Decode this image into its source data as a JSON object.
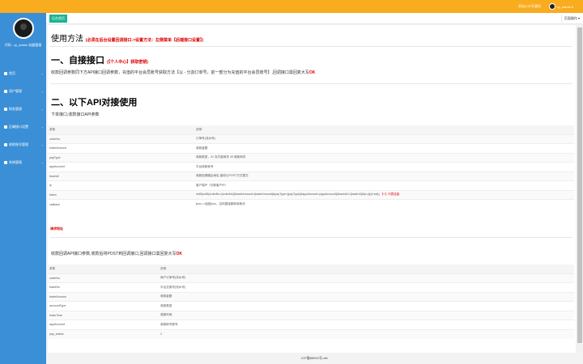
{
  "topbar": {
    "tip": "添加公众号通知",
    "username": "xy_admin"
  },
  "sidebar": {
    "user": "代码 : xy_admin  机器管理",
    "items": [
      {
        "label": "首页"
      },
      {
        "label": "用户管理"
      },
      {
        "label": "财务管理"
      },
      {
        "label": "后端接口设置"
      },
      {
        "label": "收款账号管理"
      },
      {
        "label": "系统管理"
      }
    ]
  },
  "tabs": {
    "active": "后台首页",
    "right": "页面操作"
  },
  "main": {
    "title": "使用方法",
    "title_note": "(必须在后台设置回调接口->设置方法：左侧菜单【后端接口设置】)",
    "section1": {
      "heading": "一、自接接口",
      "heading_note": "(【个人中心】获取密钥)",
      "desc": "收款回调参数同下方API接口回调参数，充值的平台会员账号获取方法【以 - 分割订单号，前一部分为充值的平台会员账号】,回调接口需回复大写",
      "desc_ok": "OK"
    },
    "section2": {
      "heading": "二、以下API对接使用",
      "sub": "下单接口,收款接口API参数"
    },
    "table1": {
      "headers": [
        "参数",
        "说明"
      ],
      "rows": [
        [
          "orderNo",
          "订单号(流水号)"
        ],
        [
          "tradeAmount",
          "收款金额"
        ],
        [
          "payType",
          "收款类型，41 支付宝网关 43 收款网关"
        ],
        [
          "appAccount",
          "平台收款帐号"
        ],
        [
          "backUrl",
          "收款回调路由地址,接收以POST方式提交"
        ],
        [
          "ip",
          "客户端IP（付款客户IP）"
        ],
        [
          "token",
          "md5(md5(orderNo={orderNo}&tradeAmount={tradeAmount}&payType={payType}&appAccount={appAccount}&backUrl={backUrl}&ip={ip}+sal))",
          "【+】代表连接"
        ],
        [
          "callback",
          "json-->返回json，否则直接跳转收款页"
        ]
      ]
    },
    "request_addr": "请求地址",
    "section3": {
      "desc": "收款回调API接口参数,收款后将POST到回调接口,回调接口需回复大写",
      "desc_ok": "OK"
    },
    "table2": {
      "headers": [
        "参数",
        "说明"
      ],
      "rows": [
        [
          "orderNo",
          "商户订单号(流水号)"
        ],
        [
          "tradeNo",
          "平台交易号(流水号)"
        ],
        [
          "tradeAmount",
          "收款金额"
        ],
        [
          "accountType",
          "收款类型"
        ],
        [
          "tradeTime",
          "收款时间"
        ],
        [
          "appAccount",
          "收款帐号账号"
        ],
        [
          "pay_status",
          "1"
        ]
      ]
    }
  },
  "footer": {
    "text": "ICP备88001号-aih"
  },
  "colors": {
    "topbar": "#f8ac1e",
    "sidebar": "#3b8fd6",
    "tab_active": "#1ab394",
    "accent_red": "#dd0000"
  }
}
